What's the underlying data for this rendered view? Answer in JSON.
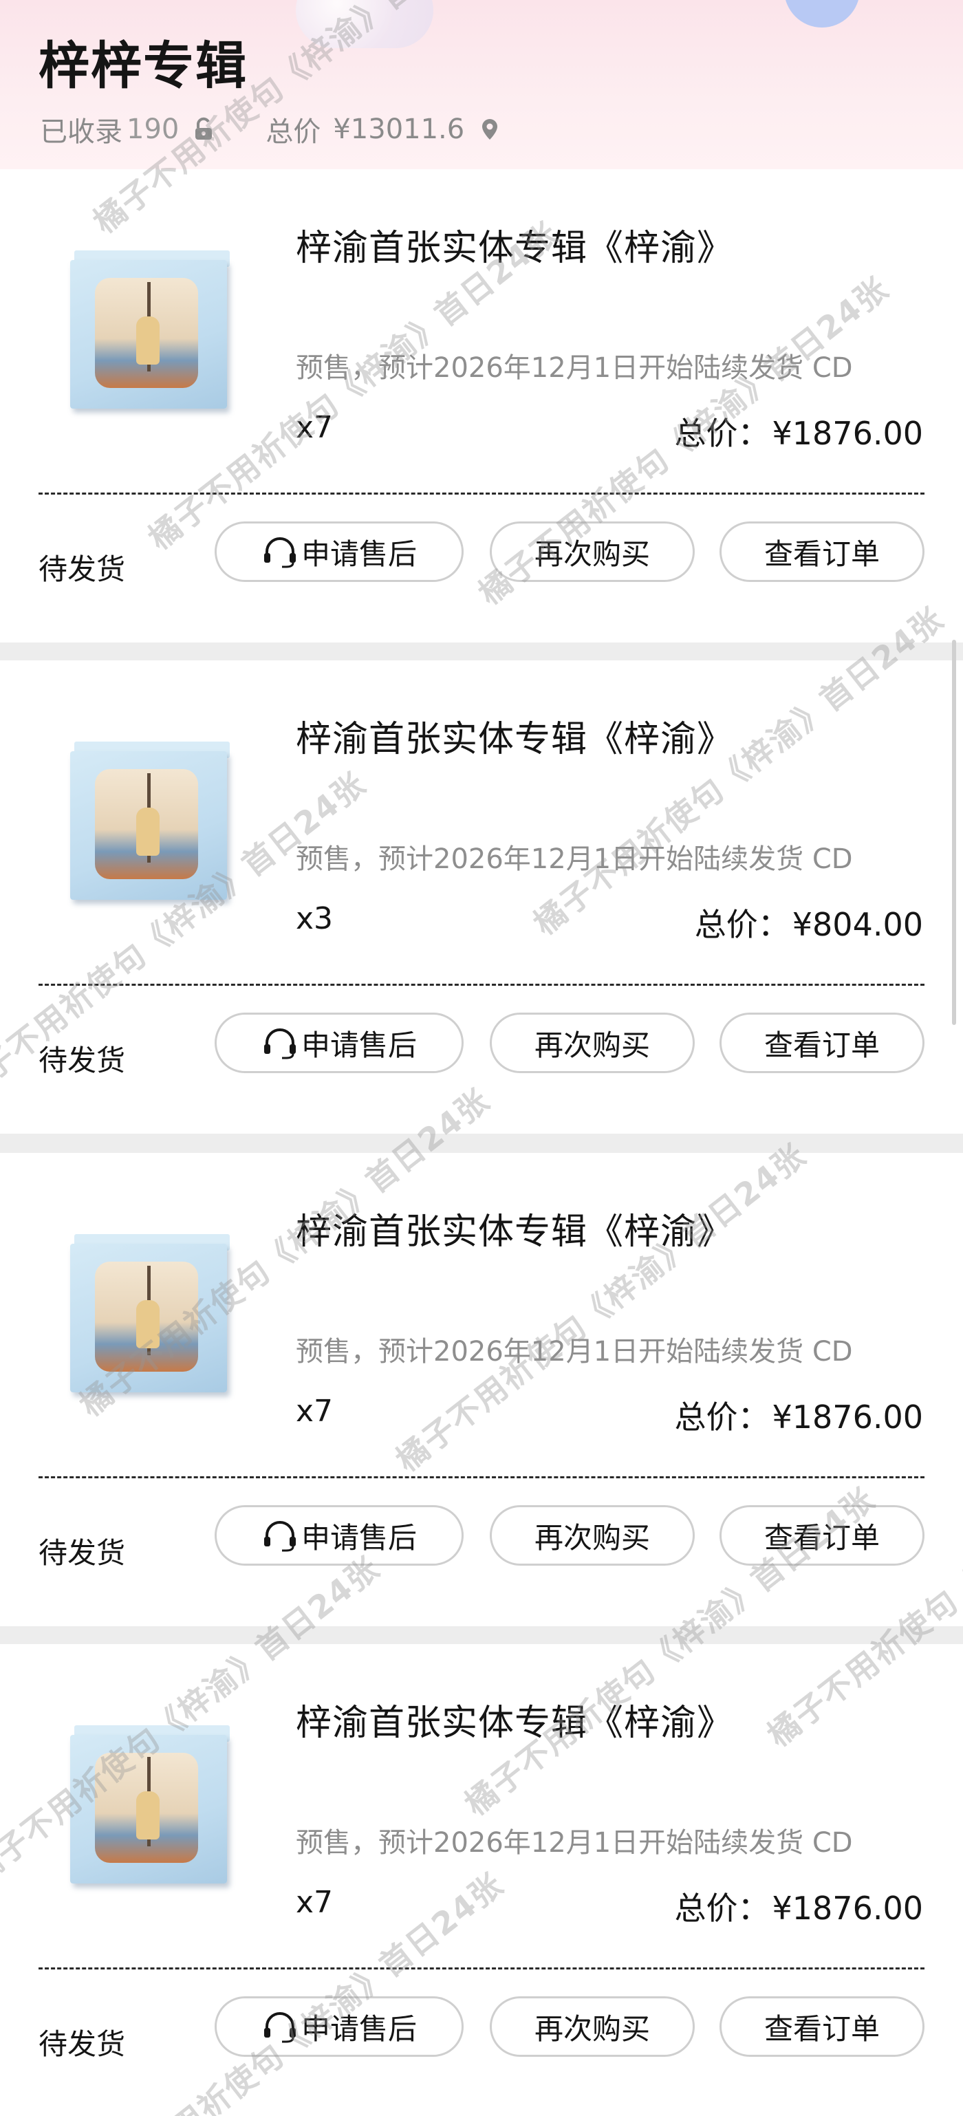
{
  "header": {
    "title": "梓梓专辑",
    "collected_label": "已收录",
    "collected_count": "190",
    "total_label": "总价",
    "total_value": "¥13011.6"
  },
  "orders": [
    {
      "product": "梓渝首张实体专辑《梓渝》",
      "presale": "预售，预计2026年12月1日开始陆续发货 CD",
      "qty": "x7",
      "price_label": "总价：",
      "price": "¥1876.00",
      "status": "待发货",
      "btn_aftersale": "申请售后",
      "btn_rebuy": "再次购买",
      "btn_view": "查看订单"
    },
    {
      "product": "梓渝首张实体专辑《梓渝》",
      "presale": "预售，预计2026年12月1日开始陆续发货 CD",
      "qty": "x3",
      "price_label": "总价：",
      "price": "¥804.00",
      "status": "待发货",
      "btn_aftersale": "申请售后",
      "btn_rebuy": "再次购买",
      "btn_view": "查看订单"
    },
    {
      "product": "梓渝首张实体专辑《梓渝》",
      "presale": "预售，预计2026年12月1日开始陆续发货 CD",
      "qty": "x7",
      "price_label": "总价：",
      "price": "¥1876.00",
      "status": "待发货",
      "btn_aftersale": "申请售后",
      "btn_rebuy": "再次购买",
      "btn_view": "查看订单"
    },
    {
      "product": "梓渝首张实体专辑《梓渝》",
      "presale": "预售，预计2026年12月1日开始陆续发货 CD",
      "qty": "x7",
      "price_label": "总价：",
      "price": "¥1876.00",
      "status": "待发货",
      "btn_aftersale": "申请售后",
      "btn_rebuy": "再次购买",
      "btn_view": "查看订单"
    }
  ],
  "icons": {
    "lock": "unlock-icon",
    "location": "location-pin-icon",
    "headset": "headset-icon"
  },
  "watermark": {
    "text": "橘子不用祈使句《梓渝》首日24张"
  },
  "colors": {
    "header_bg": "#fbe4ea",
    "page_bg": "#ededed",
    "card_bg": "#ffffff",
    "muted_text": "#8e8e8e",
    "button_border": "#cfcfcf"
  }
}
